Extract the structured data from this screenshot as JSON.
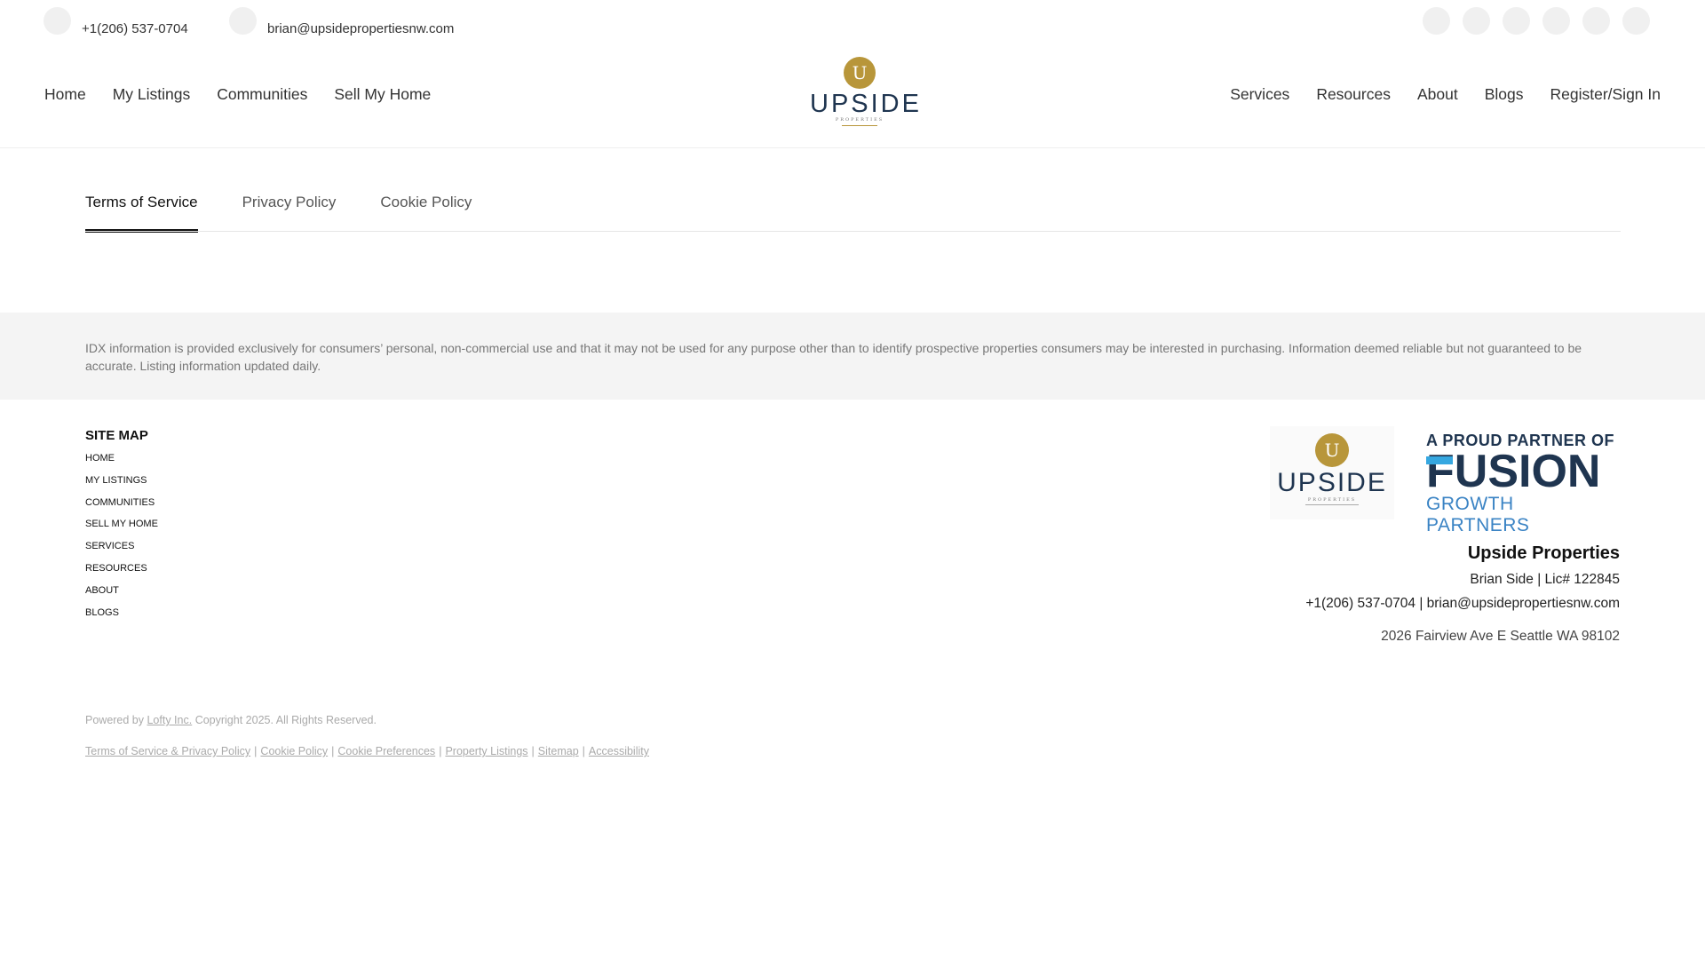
{
  "topbar": {
    "phone": "+1(206) 537-0704",
    "email": "brian@upsidepropertiesnw.com",
    "social_icons": [
      "facebook-icon",
      "instagram-icon",
      "linkedin-icon",
      "youtube-icon",
      "twitter-icon",
      "tiktok-icon"
    ]
  },
  "nav": {
    "left": [
      "Home",
      "My Listings",
      "Communities",
      "Sell My Home"
    ],
    "right": [
      "Services",
      "Resources",
      "About",
      "Blogs"
    ],
    "register": "Register/Sign In"
  },
  "logo": {
    "letter": "U",
    "name": "UPSIDE",
    "sub": "PROPERTIES"
  },
  "tabs": {
    "items": [
      "Terms of Service",
      "Privacy Policy",
      "Cookie Policy"
    ],
    "active": "Terms of Service"
  },
  "disclaimer": {
    "text": "IDX information is provided exclusively for consumers’ personal, non-commercial use and that it may not be used for any purpose other than to identify prospective properties consumers may be interested in purchasing. Information deemed reliable but not guaranteed to be accurate. Listing information updated daily."
  },
  "sitemap": {
    "title": "SITE MAP",
    "items": [
      "HOME",
      "MY LISTINGS",
      "COMMUNITIES",
      "SELL MY HOME",
      "SERVICES",
      "RESOURCES",
      "ABOUT",
      "BLOGS"
    ]
  },
  "partner_logo": {
    "line1": "A PROUD PARTNER OF",
    "line2": "FUSION",
    "line3": "GROWTH PARTNERS"
  },
  "footer": {
    "company": "Upside Properties",
    "agent": "Brian Side  |  Lic# 122845",
    "contact": "+1(206) 537-0704  |  brian@upsidepropertiesnw.com",
    "address": "2026 Fairview Ave E Seattle WA 98102"
  },
  "copyright": {
    "powered_prefix": "Powered by ",
    "powered_link": "Lofty Inc.",
    "powered_suffix": " Copyright 2025. All Rights Reserved.",
    "legal_links": [
      "Terms of Service & Privacy Policy",
      "Cookie Policy",
      "Cookie Preferences",
      "Property Listings",
      "Sitemap",
      "Accessibility"
    ]
  }
}
